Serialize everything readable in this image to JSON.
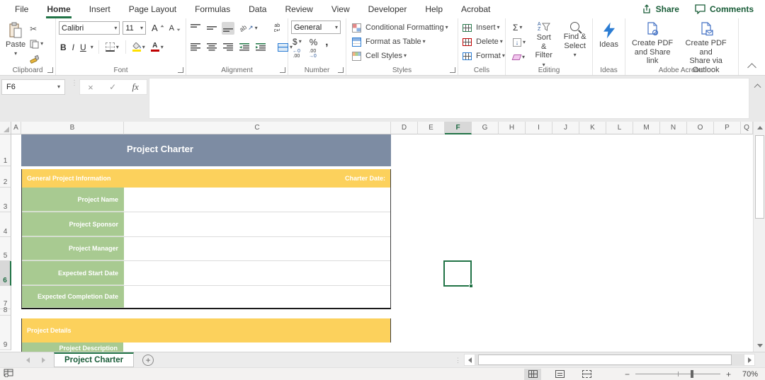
{
  "menu_bar": {
    "tabs": [
      "File",
      "Home",
      "Insert",
      "Page Layout",
      "Formulas",
      "Data",
      "Review",
      "View",
      "Developer",
      "Help",
      "Acrobat"
    ],
    "active_tab": "Home",
    "share_label": "Share",
    "comments_label": "Comments"
  },
  "ribbon": {
    "clipboard": {
      "group_label": "Clipboard",
      "paste_label": "Paste"
    },
    "font": {
      "group_label": "Font",
      "font_name": "Calibri",
      "font_size": "11",
      "bold": "B",
      "italic": "I",
      "underline": "U",
      "grow_font": "A",
      "shrink_font": "A"
    },
    "alignment": {
      "group_label": "Alignment",
      "orientation_text": "ab",
      "wrap_text": "ab"
    },
    "number": {
      "group_label": "Number",
      "format_selected": "General",
      "currency": "$",
      "percent": "%",
      "comma": ",",
      "inc_dec_top": "←0",
      "inc_dec_bottom": ".00",
      "dec_dec_top": ".00",
      "dec_dec_bottom": "→0"
    },
    "styles": {
      "group_label": "Styles",
      "conditional_formatting": "Conditional Formatting",
      "format_as_table": "Format as Table",
      "cell_styles": "Cell Styles"
    },
    "cells": {
      "group_label": "Cells",
      "insert": "Insert",
      "delete": "Delete",
      "format": "Format"
    },
    "editing": {
      "group_label": "Editing",
      "autosum": "Σ",
      "sort_a": "A",
      "sort_z": "Z",
      "sort_filter_l1": "Sort &",
      "sort_filter_l2": "Filter",
      "find_select_l1": "Find &",
      "find_select_l2": "Select"
    },
    "ideas": {
      "group_label": "Ideas",
      "ideas_label": "Ideas"
    },
    "acrobat": {
      "group_label": "Adobe Acrobat",
      "pdf_link_l1": "Create PDF",
      "pdf_link_l2": "and Share link",
      "pdf_outlook_l1": "Create PDF and",
      "pdf_outlook_l2": "Share via Outlook"
    }
  },
  "formula_bar": {
    "name_box_value": "F6",
    "cancel": "×",
    "enter": "✓",
    "insert_function": "fx",
    "formula_value": ""
  },
  "grid": {
    "column_headers": [
      "A",
      "B",
      "C",
      "D",
      "E",
      "F",
      "G",
      "H",
      "I",
      "J",
      "K",
      "L",
      "M",
      "N",
      "O",
      "P",
      "Q"
    ],
    "selected_column": "F",
    "row_headers": [
      "1",
      "2",
      "3",
      "4",
      "5",
      "6",
      "7",
      "8",
      "9"
    ],
    "selected_row": "6",
    "selected_cell": "F6"
  },
  "sheet": {
    "title": "Project Charter",
    "general_info_header": "General Project Information",
    "charter_date_label": "Charter Date:",
    "fields": [
      "Project Name",
      "Project Sponsor",
      "Project Manager",
      "Expected Start Date",
      "Expected Completion Date"
    ],
    "details_header": "Project Details",
    "next_field_partial": "Project Description"
  },
  "sheet_tabs": {
    "active_tab": "Project Charter"
  },
  "status_bar": {
    "zoom_level": "70%"
  },
  "glyphs": {
    "dropdown": "▾",
    "scissors": "✂",
    "collapse": "ᐱ"
  },
  "colors": {
    "accent_green": "#217346",
    "title_blue": "#7D8CA3",
    "band_yellow": "#FCD15C",
    "label_green": "#A8CA91"
  }
}
